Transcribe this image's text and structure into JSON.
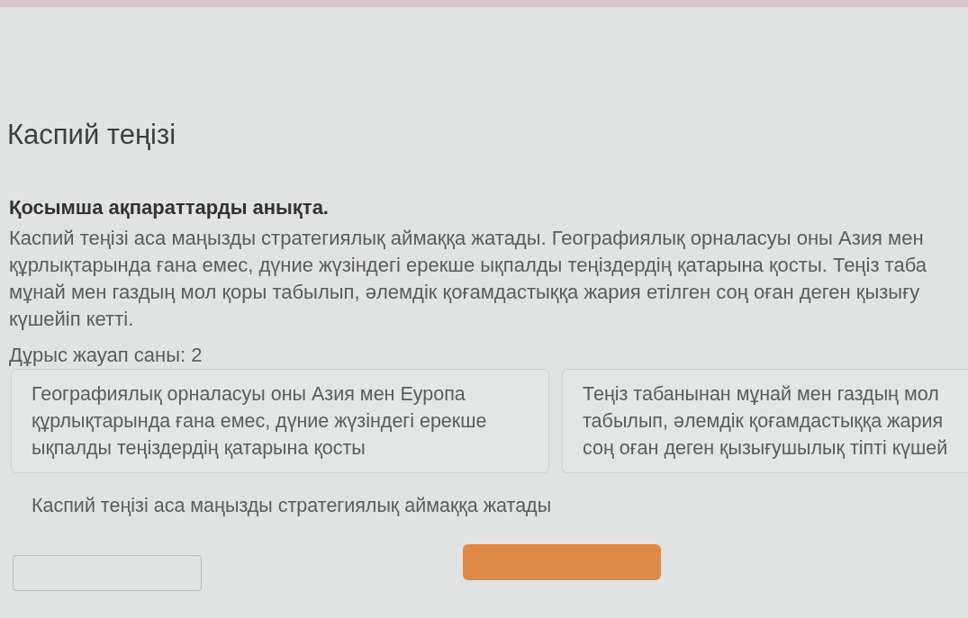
{
  "title": "Каспий теңізі",
  "instruction": "Қосымша ақпараттарды анықта.",
  "paragraph_lines": [
    "Каспий теңізі аса маңызды стратегиялық аймаққа жатады. Географиялық орналасуы оны Азия мен",
    "құрлықтарында ғана емес, дүние жүзіндегі ерекше ықпалды теңіздердің қатарына қосты. Теңіз таба",
    "мұнай мен газдың мол қоры табылып, әлемдік қоғамдастыққа жария етілген соң оған деген қызығу",
    "күшейіп кетті."
  ],
  "answer_count": "Дұрыс жауап саны: 2",
  "options": [
    {
      "kind": "card",
      "lines": [
        "Географиялық орналасуы оны Азия мен Еуропа",
        "құрлықтарында ғана емес, дүние жүзіндегі ерекше",
        "ықпалды теңіздердің қатарына қосты"
      ]
    },
    {
      "kind": "card",
      "lines": [
        "Теңіз табанынан мұнай мен газдың мол",
        "табылып, әлемдік қоғамдастыққа жария",
        "соң оған деген қызығушылық тіпті күшей"
      ]
    },
    {
      "kind": "plain",
      "lines": [
        "Каспий теңізі аса маңызды стратегиялық аймаққа жатады"
      ]
    }
  ]
}
